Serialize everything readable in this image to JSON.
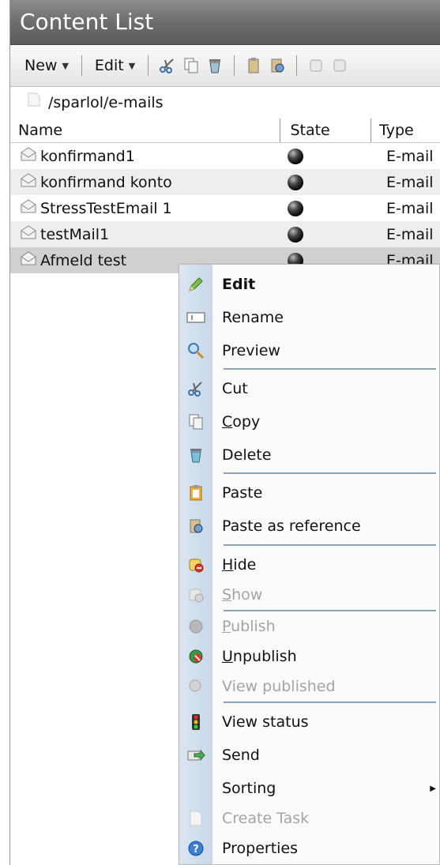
{
  "window": {
    "title": "Content List"
  },
  "toolbar": {
    "new_label": "New",
    "edit_label": "Edit",
    "icons": [
      "cut-icon",
      "copy-icon",
      "delete-icon",
      "paste-icon",
      "paste-reference-icon",
      "hide-icon",
      "show-icon"
    ]
  },
  "breadcrumb": {
    "path": "/sparlol/e-mails"
  },
  "table": {
    "headers": {
      "name": "Name",
      "state": "State",
      "type": "Type"
    },
    "rows": [
      {
        "name": "konfirmand1",
        "type": "E-mail"
      },
      {
        "name": "konfirmand konto",
        "type": "E-mail"
      },
      {
        "name": "StressTestEmail 1",
        "type": "E-mail"
      },
      {
        "name": "testMail1",
        "type": "E-mail"
      },
      {
        "name": "Afmeld test",
        "type": "E-mail"
      }
    ]
  },
  "context_menu": {
    "items": [
      {
        "label": "Edit",
        "icon": "pencil-icon",
        "enabled": true,
        "bold": true
      },
      {
        "label": "Rename",
        "icon": "rename-icon",
        "enabled": true
      },
      {
        "label": "Preview",
        "icon": "magnifier-icon",
        "enabled": true
      },
      {
        "label": "Cut",
        "icon": "scissors-icon",
        "enabled": true
      },
      {
        "label": "Copy",
        "icon": "copy-icon",
        "enabled": true,
        "underline": "C"
      },
      {
        "label": "Delete",
        "icon": "recycle-bin-icon",
        "enabled": true
      },
      {
        "label": "Paste",
        "icon": "clipboard-icon",
        "enabled": true
      },
      {
        "label": "Paste as reference",
        "icon": "paste-reference-icon",
        "enabled": true
      },
      {
        "label": "Hide",
        "icon": "hide-icon",
        "enabled": true,
        "underline": "H"
      },
      {
        "label": "Show",
        "icon": "show-icon",
        "enabled": false,
        "underline": "S"
      },
      {
        "label": "Publish",
        "icon": "publish-icon",
        "enabled": false,
        "underline": "P"
      },
      {
        "label": "Unpublish",
        "icon": "unpublish-icon",
        "enabled": true,
        "underline": "U"
      },
      {
        "label": "View published",
        "icon": "view-published-icon",
        "enabled": false
      },
      {
        "label": "View status",
        "icon": "traffic-light-icon",
        "enabled": true
      },
      {
        "label": "Send",
        "icon": "send-icon",
        "enabled": true
      },
      {
        "label": "Sorting",
        "icon": "",
        "enabled": true,
        "submenu": true
      },
      {
        "label": "Create Task",
        "icon": "task-icon",
        "enabled": false
      },
      {
        "label": "Properties",
        "icon": "info-icon",
        "enabled": true
      }
    ]
  },
  "colors": {
    "title_bar": "#6e6e6e",
    "menu_strip": "#c8d7e7",
    "selected_row": "#d0d0d0",
    "separator": "#8aa3b8"
  }
}
